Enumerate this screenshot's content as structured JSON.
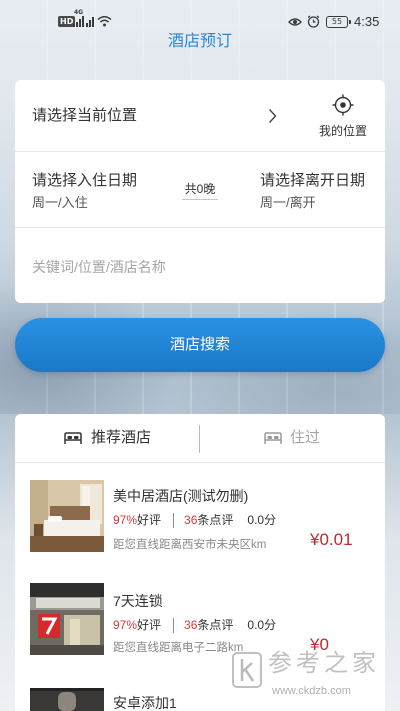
{
  "status_bar": {
    "hd_badge": "HD",
    "network": "4G",
    "battery": "55",
    "time": "4:35",
    "icons": [
      "signal-icon",
      "wifi-icon",
      "eye-icon",
      "alarm-icon",
      "battery-icon"
    ]
  },
  "header": {
    "title": "酒店预订"
  },
  "search_form": {
    "location_label": "请选择当前位置",
    "my_location_label": "我的位置",
    "checkin_label": "请选择入住日期",
    "checkin_sub": "周一/入住",
    "nights": "共0晚",
    "checkout_label": "请选择离开日期",
    "checkout_sub": "周一/离开",
    "keyword_placeholder": "关键词/位置/酒店名称",
    "keyword_value": "",
    "search_button": "酒店搜索"
  },
  "tabs": [
    {
      "label": "推荐酒店",
      "icon": "bed-icon",
      "active": true
    },
    {
      "label": "住过",
      "icon": "bed-icon",
      "active": false
    }
  ],
  "hotels": [
    {
      "name": "美中居酒店(测试勿删)",
      "rating_pct": "97%",
      "rating_label": "好评",
      "reviews_count": "36",
      "reviews_label": "条点评",
      "score": "0.0分",
      "distance": "距您直线距离西安市未央区km",
      "price": "¥0.01"
    },
    {
      "name": "7天连锁",
      "rating_pct": "97%",
      "rating_label": "好评",
      "reviews_count": "36",
      "reviews_label": "条点评",
      "score": "0.0分",
      "distance": "距您直线距离电子二路km",
      "price": "¥0"
    },
    {
      "name": "安卓添加1"
    }
  ],
  "watermark": {
    "text": "参考之家",
    "url": "www.ckdzb.com"
  },
  "colors": {
    "accent": "#1f84d6",
    "title": "#2a86d6",
    "price": "#c0282e",
    "highlight": "#d23b3b",
    "muted": "#a5a5a5"
  }
}
